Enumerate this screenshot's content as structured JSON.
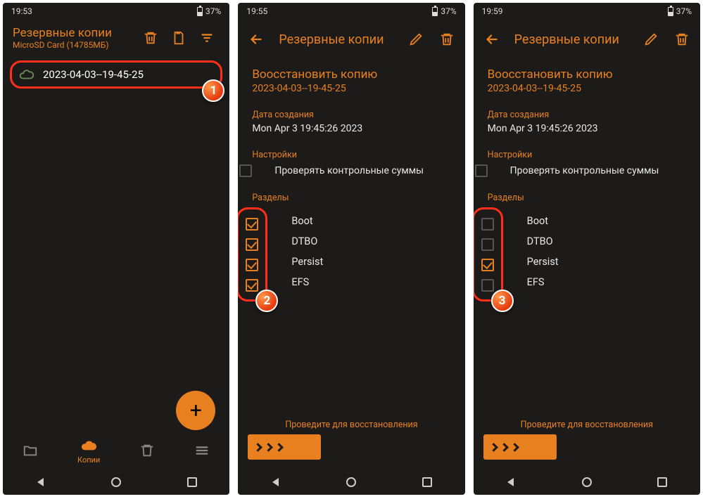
{
  "colors": {
    "accent": "#e88020",
    "highlight": "#ff2f1a",
    "bg": "#1c1b1a"
  },
  "s1": {
    "time": "19:53",
    "battery": "37%",
    "title": "Резервные копии",
    "subtitle": "MicroSD Card (14785МБ)",
    "backupName": "2023-04-03--19-45-25",
    "navLabel": "Копии",
    "badge": "1"
  },
  "s2": {
    "time": "19:55",
    "battery": "37%",
    "header": "Резервные копии",
    "title": "Воосстановить копию",
    "name": "2023-04-03--19-45-25",
    "dateLabel": "Дата создания",
    "dateValue": "Mon Apr  3 19:45:26 2023",
    "settingsLabel": "Настройки",
    "checksumsLabel": "Проверять контрольные суммы",
    "partitionsLabel": "Разделы",
    "partitions": [
      {
        "label": "Boot",
        "checked": true
      },
      {
        "label": "DTBO",
        "checked": true
      },
      {
        "label": "Persist",
        "checked": true
      },
      {
        "label": "EFS",
        "checked": true
      }
    ],
    "swipeText": "Проведите для восстановления",
    "badge": "2"
  },
  "s3": {
    "time": "19:59",
    "battery": "37%",
    "header": "Резервные копии",
    "title": "Воосстановить копию",
    "name": "2023-04-03--19-45-25",
    "dateLabel": "Дата создания",
    "dateValue": "Mon Apr  3 19:45:26 2023",
    "settingsLabel": "Настройки",
    "checksumsLabel": "Проверять контрольные суммы",
    "partitionsLabel": "Разделы",
    "partitions": [
      {
        "label": "Boot",
        "checked": false
      },
      {
        "label": "DTBO",
        "checked": false
      },
      {
        "label": "Persist",
        "checked": true
      },
      {
        "label": "EFS",
        "checked": false
      }
    ],
    "swipeText": "Проведите для восстановления",
    "badge": "3"
  }
}
